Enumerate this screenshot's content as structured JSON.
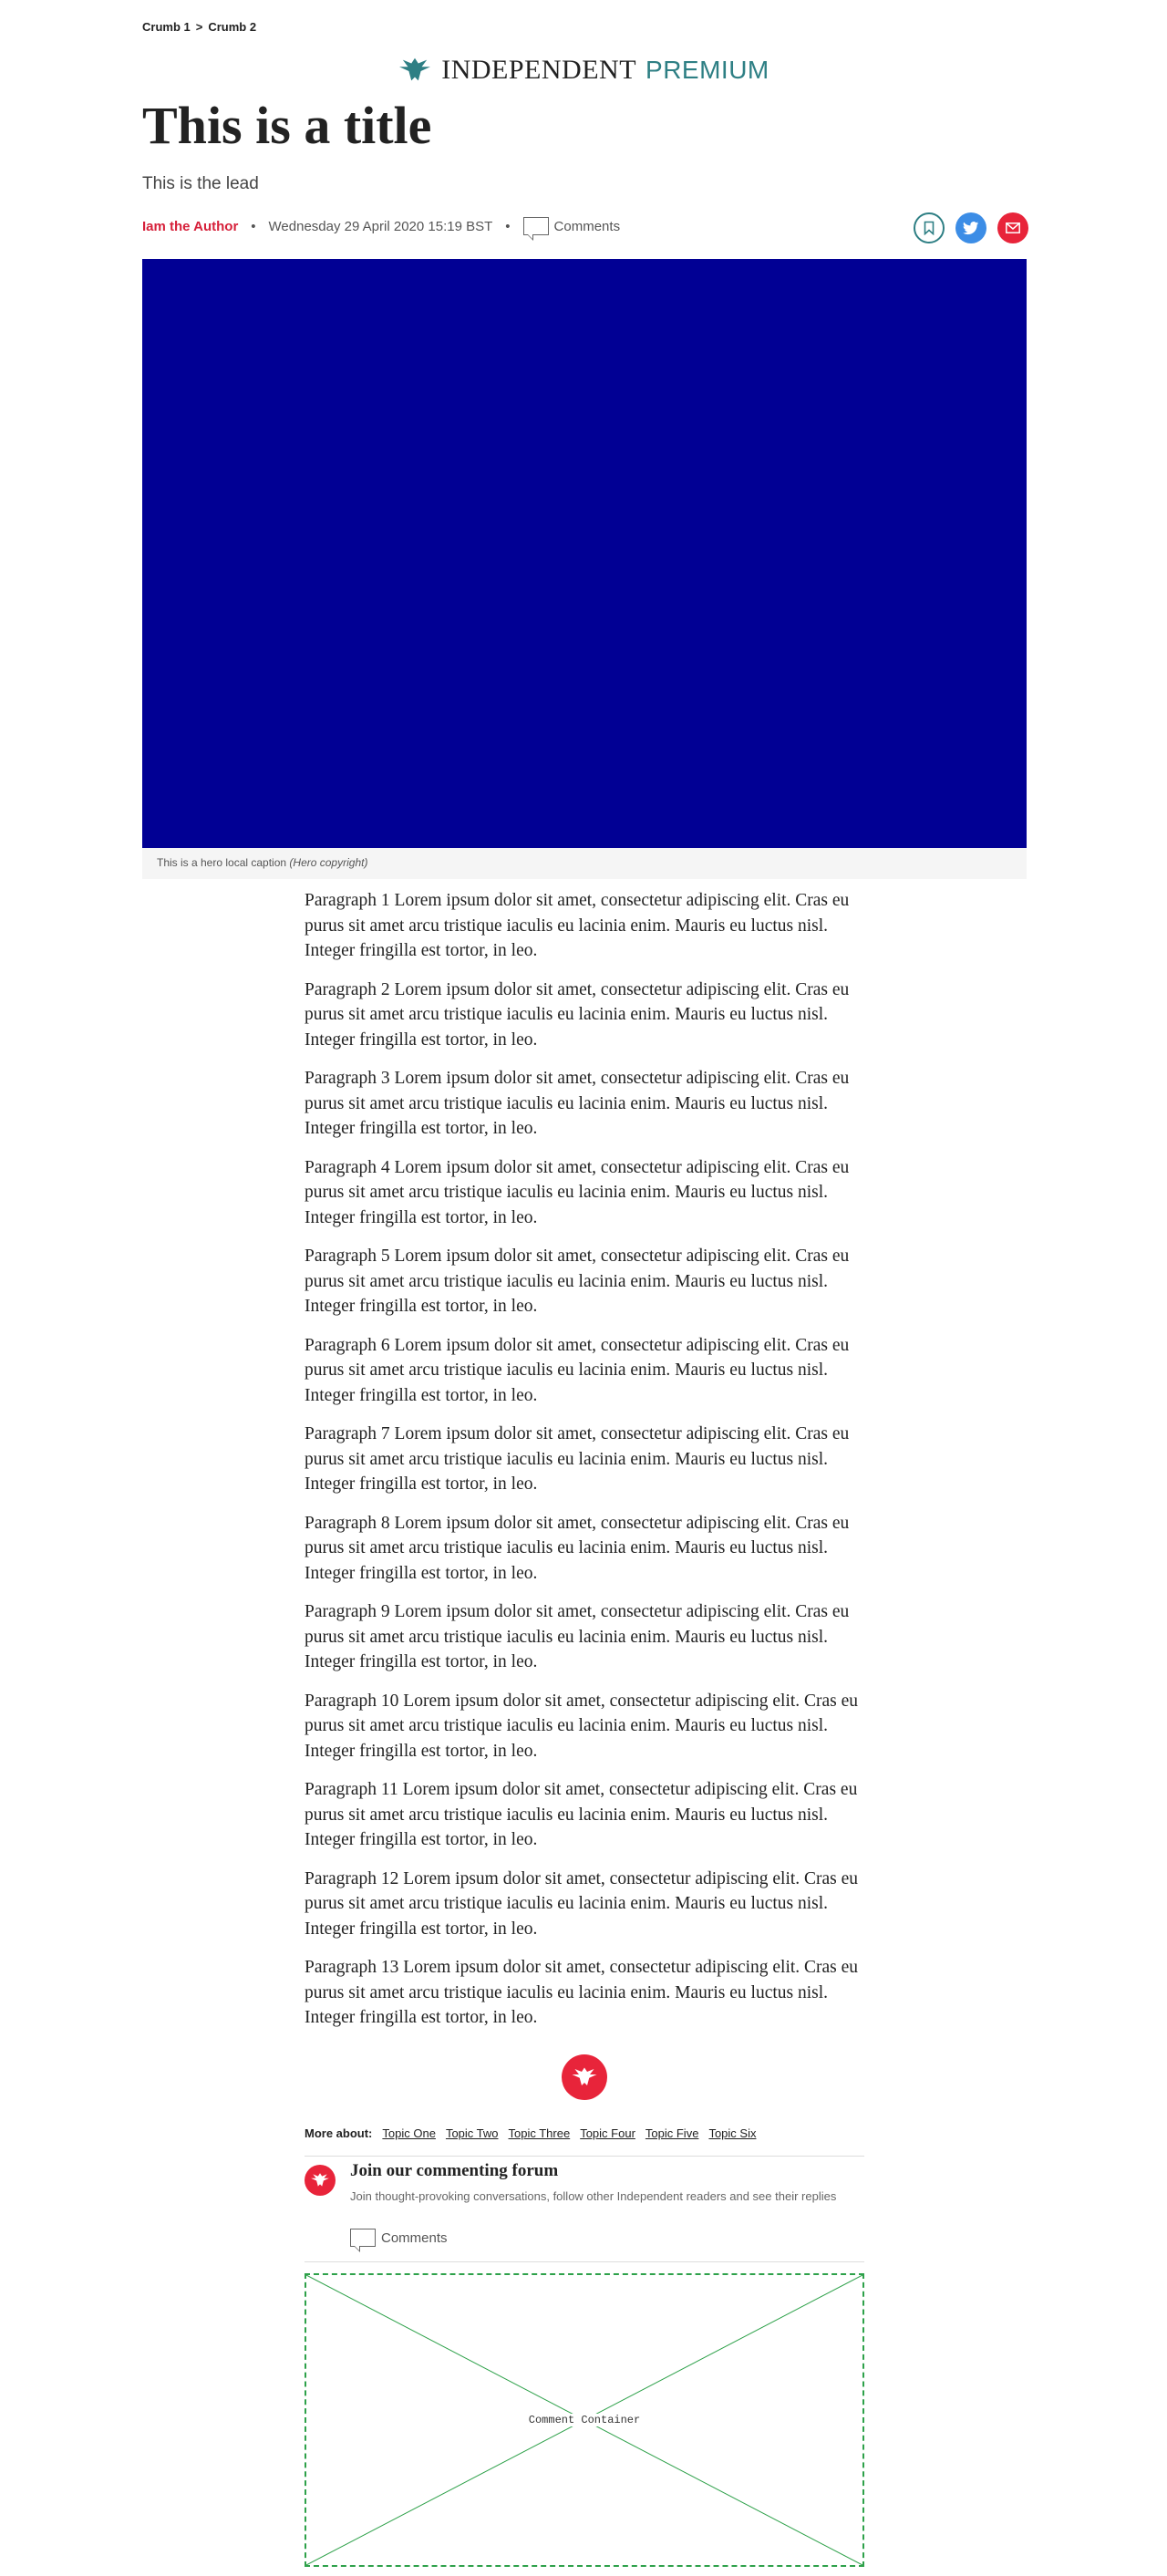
{
  "breadcrumb": {
    "items": [
      "Crumb 1",
      "Crumb 2"
    ],
    "separator": ">"
  },
  "masthead": {
    "name": "INDEPENDENT",
    "premium": "PREMIUM",
    "premium_color": "#2e7f84"
  },
  "article": {
    "title": "This is a title",
    "lead": "This is the lead",
    "author": "Iam the Author",
    "date": "Wednesday 29 April 2020 15:19 BST",
    "comments_label": "Comments",
    "hero_color": "#010094",
    "hero_caption": "This is a hero local caption",
    "hero_copyright": "(Hero copyright)",
    "paragraphs": [
      "Paragraph 1 Lorem ipsum dolor sit amet, consectetur adipiscing elit. Cras eu purus sit amet arcu tristique iaculis eu lacinia enim. Mauris eu luctus nisl. Integer fringilla est tortor, in leo.",
      "Paragraph 2 Lorem ipsum dolor sit amet, consectetur adipiscing elit. Cras eu purus sit amet arcu tristique iaculis eu lacinia enim. Mauris eu luctus nisl. Integer fringilla est tortor, in leo.",
      "Paragraph 3 Lorem ipsum dolor sit amet, consectetur adipiscing elit. Cras eu purus sit amet arcu tristique iaculis eu lacinia enim. Mauris eu luctus nisl. Integer fringilla est tortor, in leo.",
      "Paragraph 4 Lorem ipsum dolor sit amet, consectetur adipiscing elit. Cras eu purus sit amet arcu tristique iaculis eu lacinia enim. Mauris eu luctus nisl. Integer fringilla est tortor, in leo.",
      "Paragraph 5 Lorem ipsum dolor sit amet, consectetur adipiscing elit. Cras eu purus sit amet arcu tristique iaculis eu lacinia enim. Mauris eu luctus nisl. Integer fringilla est tortor, in leo.",
      "Paragraph 6 Lorem ipsum dolor sit amet, consectetur adipiscing elit. Cras eu purus sit amet arcu tristique iaculis eu lacinia enim. Mauris eu luctus nisl. Integer fringilla est tortor, in leo.",
      "Paragraph 7 Lorem ipsum dolor sit amet, consectetur adipiscing elit. Cras eu purus sit amet arcu tristique iaculis eu lacinia enim. Mauris eu luctus nisl. Integer fringilla est tortor, in leo.",
      "Paragraph 8 Lorem ipsum dolor sit amet, consectetur adipiscing elit. Cras eu purus sit amet arcu tristique iaculis eu lacinia enim. Mauris eu luctus nisl. Integer fringilla est tortor, in leo.",
      "Paragraph 9 Lorem ipsum dolor sit amet, consectetur adipiscing elit. Cras eu purus sit amet arcu tristique iaculis eu lacinia enim. Mauris eu luctus nisl. Integer fringilla est tortor, in leo.",
      "Paragraph 10 Lorem ipsum dolor sit amet, consectetur adipiscing elit. Cras eu purus sit amet arcu tristique iaculis eu lacinia enim. Mauris eu luctus nisl. Integer fringilla est tortor, in leo.",
      "Paragraph 11 Lorem ipsum dolor sit amet, consectetur adipiscing elit. Cras eu purus sit amet arcu tristique iaculis eu lacinia enim. Mauris eu luctus nisl. Integer fringilla est tortor, in leo.",
      "Paragraph 12 Lorem ipsum dolor sit amet, consectetur adipiscing elit. Cras eu purus sit amet arcu tristique iaculis eu lacinia enim. Mauris eu luctus nisl. Integer fringilla est tortor, in leo.",
      "Paragraph 13 Lorem ipsum dolor sit amet, consectetur adipiscing elit. Cras eu purus sit amet arcu tristique iaculis eu lacinia enim. Mauris eu luctus nisl. Integer fringilla est tortor, in leo."
    ]
  },
  "share": {
    "icons": [
      "bookmark-icon",
      "twitter-icon",
      "email-icon"
    ]
  },
  "more_about": {
    "label": "More about:",
    "topics": [
      "Topic One",
      "Topic Two",
      "Topic Three",
      "Topic Four",
      "Topic Five",
      "Topic Six"
    ]
  },
  "forum": {
    "title": "Join our commenting forum",
    "description": "Join thought-provoking conversations, follow other Independent readers and see their replies",
    "comments_label": "Comments"
  },
  "comment_container": {
    "label": "Comment Container"
  },
  "colors": {
    "accent_red": "#e8243a",
    "author_red": "#d6203a",
    "twitter_blue": "#3c8de6",
    "placeholder_green": "#2ea14a"
  }
}
